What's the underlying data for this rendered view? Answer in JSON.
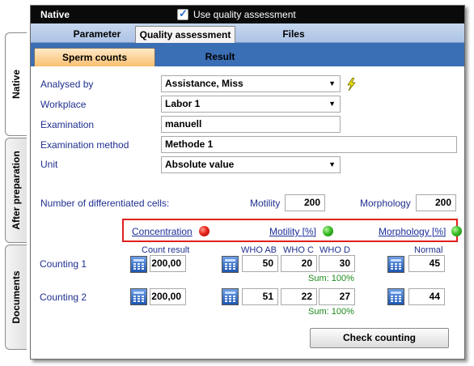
{
  "side_tabs": [
    {
      "label": "Native"
    },
    {
      "label": "After preparation"
    },
    {
      "label": "Documents"
    }
  ],
  "window": {
    "title": "Native"
  },
  "quality_assessment": {
    "checked": true,
    "label": "Use quality assessment"
  },
  "main_tabs": [
    {
      "label": "Parameter"
    },
    {
      "label": "Quality assessment"
    },
    {
      "label": "Files"
    }
  ],
  "sub_tabs": [
    {
      "label": "Sperm counts"
    },
    {
      "label": "Result"
    }
  ],
  "form": {
    "analysed_by": {
      "label": "Analysed by",
      "value": "Assistance, Miss"
    },
    "workplace": {
      "label": "Workplace",
      "value": "Labor 1"
    },
    "examination": {
      "label": "Examination",
      "value": "manuell"
    },
    "examination_method": {
      "label": "Examination method",
      "value": "Methode 1"
    },
    "unit": {
      "label": "Unit",
      "value": "Absolute value"
    }
  },
  "differentiated": {
    "label": "Number of differentiated cells:",
    "motility_label": "Motility",
    "motility_value": "200",
    "morphology_label": "Morphology",
    "morphology_value": "200"
  },
  "indicators": [
    {
      "label": "Concentration",
      "status": "red",
      "color": "#e8251c"
    },
    {
      "label": "Motility [%]",
      "status": "green",
      "color": "#3bbf2a"
    },
    {
      "label": "Morphology [%]",
      "status": "green",
      "color": "#3bbf2a"
    }
  ],
  "columns": {
    "count_result": "Count result",
    "who_ab": "WHO AB",
    "who_c": "WHO C",
    "who_d": "WHO  D",
    "normal": "Normal"
  },
  "countings": [
    {
      "label": "Counting 1",
      "count_result": "200,00",
      "who_ab": "50",
      "who_c": "20",
      "who_d": "30",
      "sum": "Sum: 100%",
      "normal": "45"
    },
    {
      "label": "Counting 2",
      "count_result": "200,00",
      "who_ab": "51",
      "who_c": "22",
      "who_d": "27",
      "sum": "Sum: 100%",
      "normal": "44"
    }
  ],
  "check_button": {
    "label": "Check counting"
  },
  "colors": {
    "title_bar": "#0a0a0a",
    "subtab_bar": "#3b6fb5",
    "active_subtab": "#f9bf72",
    "label_text": "#1f2f8f",
    "highlight_box": "#e0201d"
  }
}
